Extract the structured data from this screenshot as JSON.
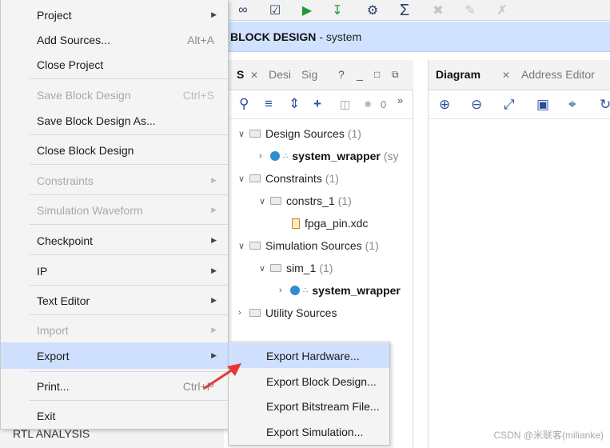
{
  "toolbar": {
    "icons": [
      "link-icon",
      "checkmark-icon",
      "run-icon",
      "program-icon",
      "gear-icon",
      "sigma-icon",
      "debug-icon",
      "edit-icon",
      "tools-icon"
    ]
  },
  "titlebar": {
    "strong": "BLOCK DESIGN",
    "rest": "- system"
  },
  "sources_panel": {
    "tabs": [
      "S",
      "Desi",
      "Sig"
    ],
    "count_badge": "0",
    "more": "»",
    "tree": {
      "design_sources": {
        "label": "Design Sources",
        "count": "(1)"
      },
      "system_wrapper_1": {
        "label": "system_wrapper",
        "suffix": "(sy"
      },
      "constraints": {
        "label": "Constraints",
        "count": "(1)"
      },
      "constrs_1": {
        "label": "constrs_1",
        "count": "(1)"
      },
      "fpga_pin": {
        "label": "fpga_pin.xdc"
      },
      "simulation_sources": {
        "label": "Simulation Sources",
        "count": "(1)"
      },
      "sim_1": {
        "label": "sim_1",
        "count": "(1)"
      },
      "system_wrapper_2": {
        "label": "system_wrapper"
      },
      "utility_sources": {
        "label": "Utility Sources"
      }
    }
  },
  "diagram_panel": {
    "tab_active": "Diagram",
    "tab_other": "Address Editor"
  },
  "bottom_peek": "RTL ANALYSIS",
  "menu": {
    "items": [
      {
        "label": "Project",
        "has_submenu": true
      },
      {
        "label": "Add Sources...",
        "accel": "Alt+A"
      },
      {
        "label": "Close Project"
      },
      {
        "label": "Save Block Design",
        "accel": "Ctrl+S",
        "disabled": true
      },
      {
        "label": "Save Block Design As..."
      },
      {
        "label": "Close Block Design"
      },
      {
        "label": "Constraints",
        "has_submenu": true,
        "disabled": true
      },
      {
        "label": "Simulation Waveform",
        "has_submenu": true,
        "disabled": true
      },
      {
        "label": "Checkpoint",
        "has_submenu": true
      },
      {
        "label": "IP",
        "has_submenu": true
      },
      {
        "label": "Text Editor",
        "has_submenu": true
      },
      {
        "label": "Import",
        "has_submenu": true,
        "disabled": true
      },
      {
        "label": "Export",
        "has_submenu": true,
        "highlighted": true
      },
      {
        "label": "Print...",
        "accel": "Ctrl+P"
      },
      {
        "label": "Exit"
      }
    ]
  },
  "export_submenu": {
    "items": [
      {
        "label": "Export Hardware...",
        "highlighted": true
      },
      {
        "label": "Export Block Design..."
      },
      {
        "label": "Export Bitstream File..."
      },
      {
        "label": "Export Simulation..."
      }
    ]
  },
  "watermark": "CSDN @米联客(milianke)",
  "colors": {
    "highlight": "#cfe0ff",
    "titlebar": "#d0e2ff",
    "arrow": "#e53935"
  }
}
